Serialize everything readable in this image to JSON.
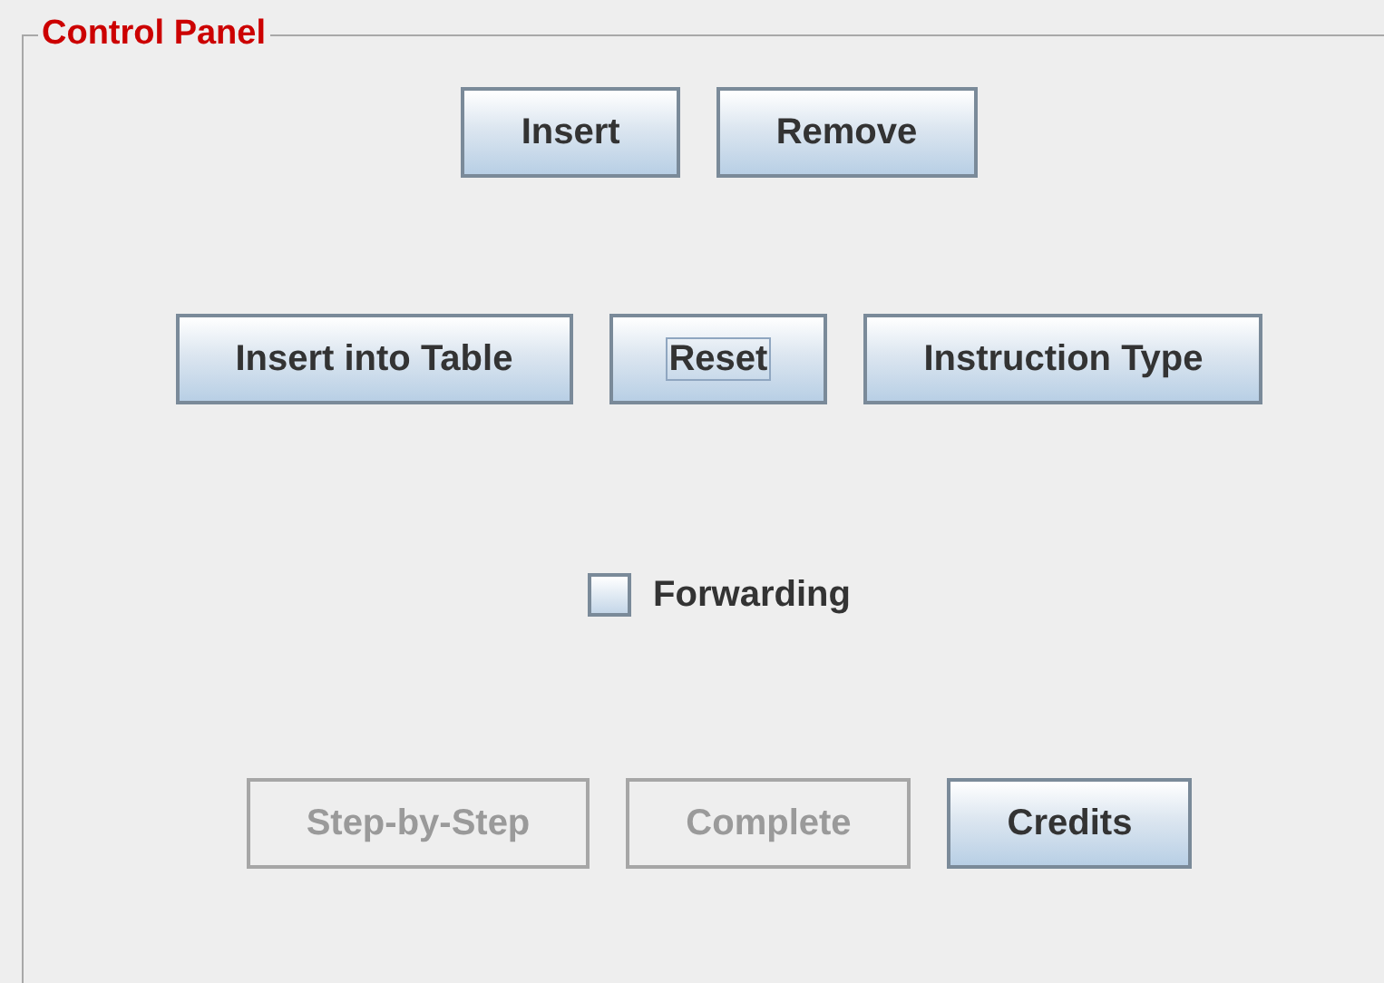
{
  "panel": {
    "title": "Control Panel"
  },
  "button_rows": [
    {
      "buttons": [
        {
          "label": "Insert",
          "disabled": false,
          "focused": false
        },
        {
          "label": "Remove",
          "disabled": false,
          "focused": false
        }
      ]
    },
    {
      "buttons": [
        {
          "label": "Insert into Table",
          "disabled": false,
          "focused": false
        },
        {
          "label": "Reset",
          "disabled": false,
          "focused": true
        },
        {
          "label": "Instruction Type",
          "disabled": false,
          "focused": false
        }
      ]
    }
  ],
  "forwarding": {
    "label": "Forwarding",
    "checked": false
  },
  "bottom_buttons": [
    {
      "label": "Step-by-Step",
      "disabled": true,
      "focused": false
    },
    {
      "label": "Complete",
      "disabled": true,
      "focused": false
    },
    {
      "label": "Credits",
      "disabled": false,
      "focused": false
    }
  ]
}
